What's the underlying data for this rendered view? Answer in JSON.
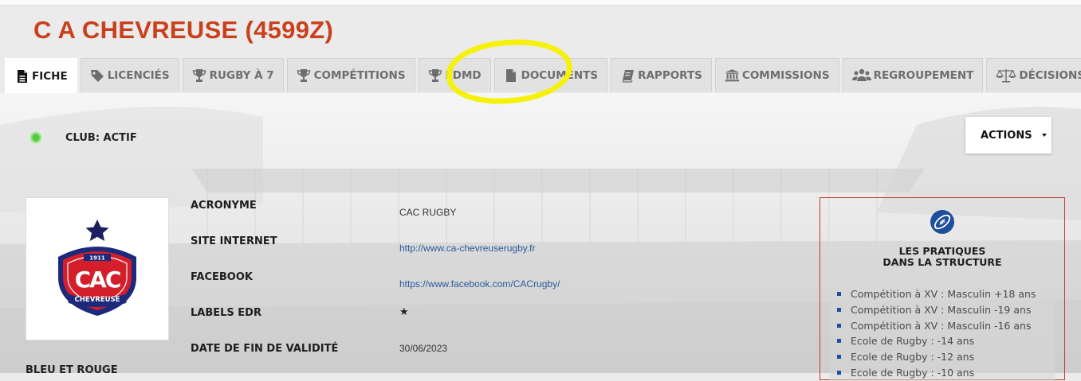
{
  "page": {
    "title": "C A CHEVREUSE (4599Z)"
  },
  "tabs": [
    {
      "label": "FICHE",
      "icon": "document-icon",
      "active": true
    },
    {
      "label": "LICENCIÉS",
      "icon": "tag-icon",
      "active": false
    },
    {
      "label": "RUGBY À 7",
      "icon": "trophy-icon",
      "active": false
    },
    {
      "label": "COMPÉTITIONS",
      "icon": "trophy-icon",
      "active": false
    },
    {
      "label": "FDMD",
      "icon": "trophy-icon",
      "active": false
    },
    {
      "label": "DOCUMENTS",
      "icon": "file-icon",
      "active": false
    },
    {
      "label": "RAPPORTS",
      "icon": "book-icon",
      "active": false
    },
    {
      "label": "COMMISSIONS",
      "icon": "institution-icon",
      "active": false
    },
    {
      "label": "REGROUPEMENT",
      "icon": "users-icon",
      "active": false
    },
    {
      "label": "DÉCISIONS",
      "icon": "balance-scale-icon",
      "active": false
    }
  ],
  "status": {
    "text": "CLUB: ACTIF",
    "color": "#52c83a"
  },
  "actions": {
    "label": "ACTIONS"
  },
  "club": {
    "logo": {
      "year": "1911",
      "letters": "CAC",
      "name": "CHEVREUSE"
    },
    "colors_label": "BLEU ET ROUGE"
  },
  "fields": {
    "acronyme_label": "ACRONYME",
    "acronyme_value": "CAC RUGBY",
    "site_label": "SITE INTERNET",
    "site_value": "http://www.ca-chevreuserugby.fr",
    "facebook_label": "FACEBOOK",
    "facebook_value": "https://www.facebook.com/CACrugby/",
    "labels_label": "LABELS EDR",
    "labels_value": "★",
    "validite_label": "DATE DE FIN DE VALIDITÉ",
    "validite_value": "30/06/2023"
  },
  "practices_panel": {
    "icon": "football-icon",
    "title_line1": "LES PRATIQUES",
    "title_line2": "DANS LA STRUCTURE",
    "items": [
      "Compétition à XV : Masculin +18 ans",
      "Compétition à XV : Masculin -19 ans",
      "Compétition à XV : Masculin -16 ans",
      "Ecole de Rugby : -14 ans",
      "Ecole de Rugby : -12 ans",
      "Ecole de Rugby : -10 ans"
    ]
  },
  "colors": {
    "title": "#c9411c",
    "link": "#2a5a9c",
    "panel_border": "#c0392b",
    "bullet": "#1f4e9c",
    "highlight": "#f5f10a"
  }
}
